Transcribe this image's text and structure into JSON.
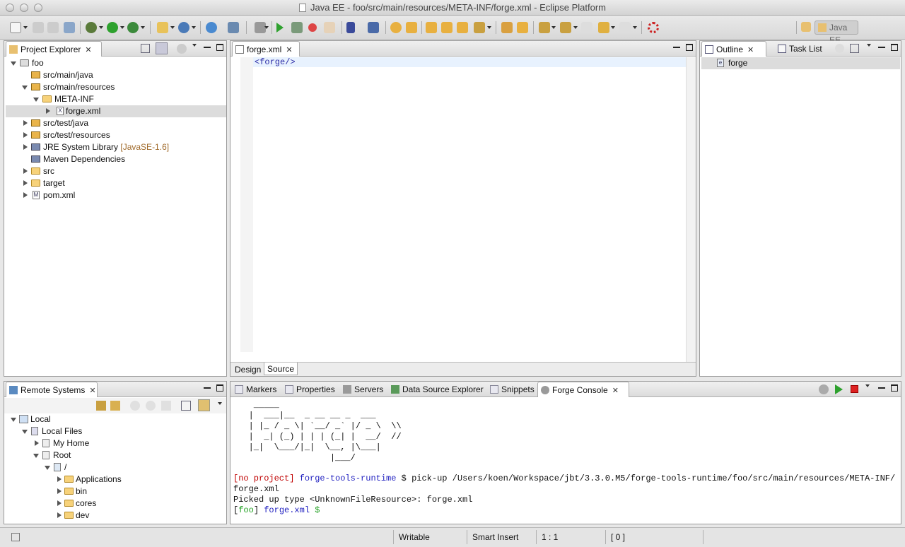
{
  "window": {
    "title": "Java EE - foo/src/main/resources/META-INF/forge.xml - Eclipse Platform"
  },
  "toolbar": {
    "perspective": "Java EE"
  },
  "project_explorer": {
    "title": "Project Explorer",
    "items": [
      {
        "label": "foo"
      },
      {
        "label": "src/main/java"
      },
      {
        "label": "src/main/resources"
      },
      {
        "label": "META-INF"
      },
      {
        "label": "forge.xml"
      },
      {
        "label": "src/test/java"
      },
      {
        "label": "src/test/resources"
      },
      {
        "label": "JRE System Library",
        "suffix": "[JavaSE-1.6]"
      },
      {
        "label": "Maven Dependencies"
      },
      {
        "label": "src"
      },
      {
        "label": "target"
      },
      {
        "label": "pom.xml"
      }
    ]
  },
  "editor": {
    "tab": "forge.xml",
    "content": "<forge/>",
    "bottom_tabs": [
      "Design",
      "Source"
    ]
  },
  "outline": {
    "tabs": [
      "Outline",
      "Task List"
    ],
    "items": [
      {
        "label": "forge"
      }
    ]
  },
  "remote_systems": {
    "title": "Remote Systems",
    "items": [
      {
        "label": "Local"
      },
      {
        "label": "Local Files"
      },
      {
        "label": "My Home"
      },
      {
        "label": "Root"
      },
      {
        "label": "/"
      },
      {
        "label": "Applications"
      },
      {
        "label": "bin"
      },
      {
        "label": "cores"
      },
      {
        "label": "dev"
      }
    ]
  },
  "console": {
    "tabs": [
      "Markers",
      "Properties",
      "Servers",
      "Data Source Explorer",
      "Snippets",
      "Forge Console"
    ],
    "ascii": "    _____\n   |  ___|__  _ __ __ _  ___\n   | |_ / _ \\| `__/ _` |/ _ \\  \\\\\n   |  _| (_) | | | (_| |  __/  //\n   |_|  \\___/|_|  \\__, |\\___|\n                   |___/",
    "line1_project": "[no project]",
    "line1_runtime": "forge-tools-runtime",
    "line1_prompt": "$",
    "line1_cmd": "pick-up /Users/koen/Workspace/jbt/3.3.0.M5/forge-tools-runtime/foo/src/main/resources/META-INF/",
    "line2": "forge.xml",
    "line3": "Picked up type <UnknownFileResource>: forge.xml",
    "line4_open": "[",
    "line4_project": "foo",
    "line4_close": "]",
    "line4_file": "forge.xml",
    "line4_prompt": "$"
  },
  "statusbar": {
    "writable": "Writable",
    "insert": "Smart Insert",
    "position": "1 : 1",
    "selection": "[ 0 ]"
  },
  "colors": {
    "project": "#c00000",
    "runtime": "#2020c0",
    "green": "#20a020",
    "selection": "#dcdcdc"
  }
}
